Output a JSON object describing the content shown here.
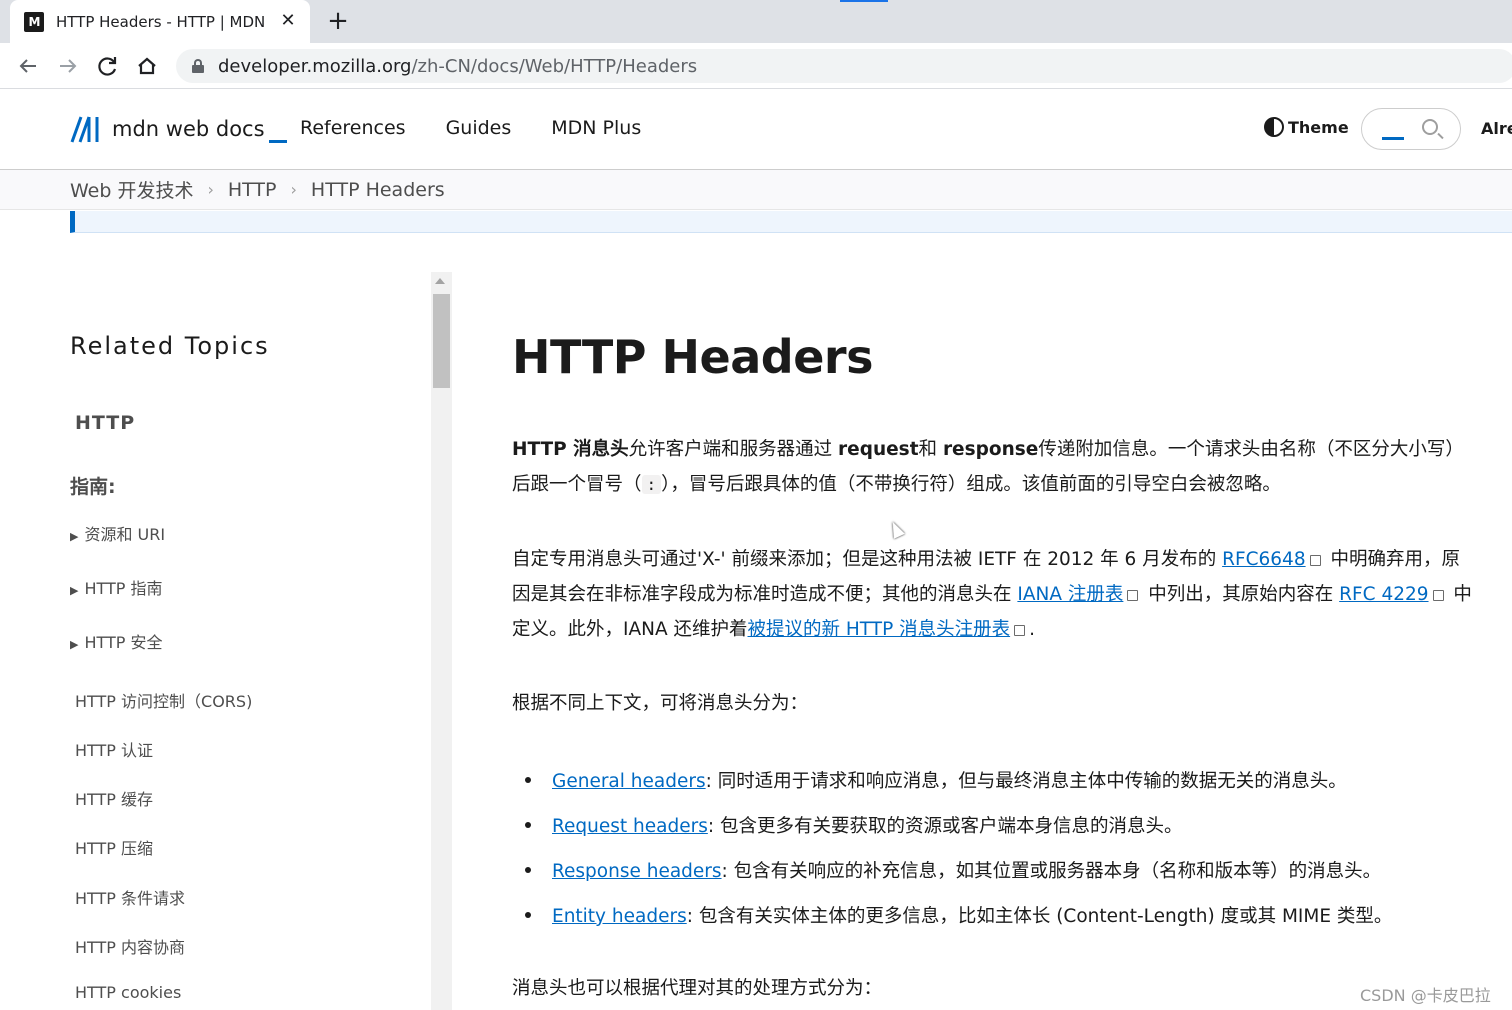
{
  "browser": {
    "tab_title": "HTTP Headers - HTTP | MDN",
    "tab_favicon": "M",
    "close_symbol": "✕",
    "new_tab_symbol": "+",
    "url_host": "developer.mozilla.org",
    "url_path": "/zh-CN/docs/Web/HTTP/Headers",
    "accent_color": "#1a73e8"
  },
  "header": {
    "logo_mark": "M",
    "logo_text": "mdn web docs",
    "nav": [
      "References",
      "Guides",
      "MDN Plus"
    ],
    "theme_label": "Theme",
    "already_label": "Alre",
    "brand_color": "#0069c2"
  },
  "breadcrumb": [
    "Web 开发技术",
    "HTTP",
    "HTTP Headers"
  ],
  "sidebar": {
    "title": "Related Topics",
    "section": "HTTP",
    "guides_label": "指南:",
    "collapsibles": [
      "资源和 URI",
      "HTTP 指南",
      "HTTP 安全"
    ],
    "links": [
      "HTTP 访问控制（CORS)",
      "HTTP 认证",
      "HTTP 缓存",
      "HTTP 压缩",
      "HTTP 条件请求",
      "HTTP 内容协商",
      "HTTP cookies"
    ]
  },
  "article": {
    "title": "HTTP Headers",
    "p1": {
      "bold1": "HTTP 消息头",
      "t1": "允许客户端和服务器通过 ",
      "bold2": "request",
      "t2": "和 ",
      "bold3": "response",
      "t3": "传递附加信息。一个请求头由名称（不区分大小写）后跟一个冒号（",
      "colon": ":",
      "t4": "），冒号后跟具体的值（不带换行符）组成。该值前面的引导空白会被忽略。"
    },
    "p2": {
      "t1": "自定专用消息头可通过'X-' 前缀来添加；但是这种用法被 IETF 在 2012 年 6 月发布的 ",
      "link1": "RFC6648",
      "t2": " 中明确弃用，原因是其会在非标准字段成为标准时造成不便；其他的消息头在 ",
      "link2": "IANA 注册表",
      "t3": " 中列出，其原始内容在 ",
      "link3": "RFC 4229",
      "t4": " 中定义。此外，IANA 还维护着",
      "link4": "被提议的新 HTTP 消息头注册表",
      "t5": "."
    },
    "p3": "根据不同上下文，可将消息头分为：",
    "bullets": [
      {
        "link": "General headers",
        "text": ": 同时适用于请求和响应消息，但与最终消息主体中传输的数据无关的消息头。"
      },
      {
        "link": "Request headers",
        "text": ": 包含更多有关要获取的资源或客户端本身信息的消息头。"
      },
      {
        "link": "Response headers",
        "text": ": 包含有关响应的补充信息，如其位置或服务器本身（名称和版本等）的消息头。"
      },
      {
        "link": "Entity headers",
        "text": ": 包含有关实体主体的更多信息，比如主体长 (Content-Length) 度或其 MIME 类型。"
      }
    ],
    "p4": "消息头也可以根据代理对其的处理方式分为："
  },
  "watermark": "CSDN @卡皮巴拉"
}
